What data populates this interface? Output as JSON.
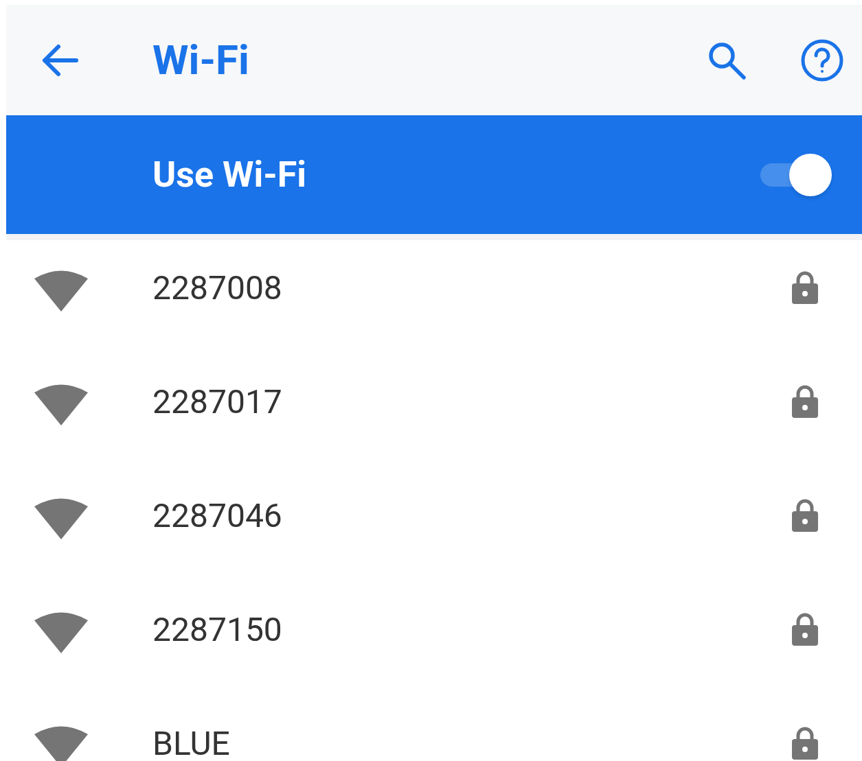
{
  "app_bar": {
    "title": "Wi-Fi"
  },
  "master_switch": {
    "label": "Use Wi-Fi",
    "on": true
  },
  "networks": [
    {
      "name": "2287008",
      "secured": true
    },
    {
      "name": "2287017",
      "secured": true
    },
    {
      "name": "2287046",
      "secured": true
    },
    {
      "name": "2287150",
      "secured": true
    },
    {
      "name": "BLUE",
      "secured": true
    }
  ]
}
